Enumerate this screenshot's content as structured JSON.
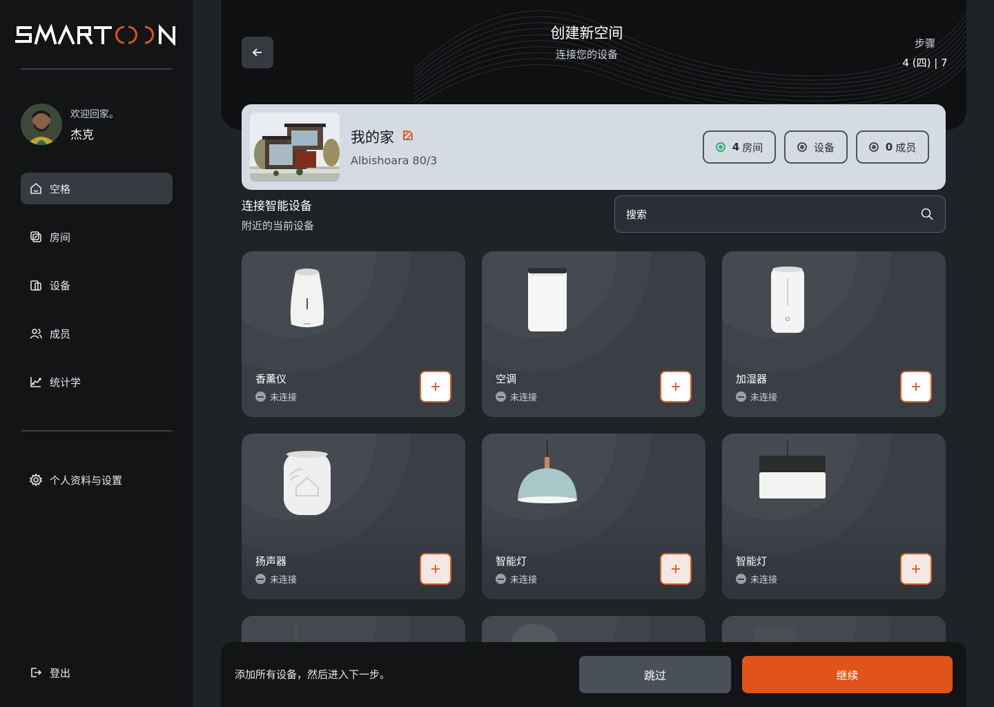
{
  "app": {
    "logo": "SMARTOON"
  },
  "user": {
    "greeting": "欢迎回家。",
    "name": "杰克"
  },
  "sidebar": {
    "items": [
      {
        "label": "空格",
        "icon": "home-icon",
        "active": true
      },
      {
        "label": "房间",
        "icon": "room-icon",
        "active": false
      },
      {
        "label": "设备",
        "icon": "device-icon",
        "active": false
      },
      {
        "label": "成员",
        "icon": "members-icon",
        "active": false
      },
      {
        "label": "统计学",
        "icon": "stats-icon",
        "active": false
      }
    ],
    "settings_label": "个人资料与设置",
    "logout_label": "登出"
  },
  "header": {
    "title": "创建新空间",
    "subtitle": "连接您的设备",
    "step_label": "步骤",
    "step_value": "4 (四) | 7"
  },
  "home": {
    "name": "我的家",
    "address": "Albishoara 80/3",
    "chips": [
      {
        "count": "4",
        "label": "房间",
        "dot_color": "#2fb36b"
      },
      {
        "count": "",
        "label": "设备",
        "dot_color": "#4a4f57"
      },
      {
        "count": "0",
        "label": "成员",
        "dot_color": "#4a4f57"
      }
    ]
  },
  "devices_section": {
    "title": "连接智能设备",
    "subtitle": "附近的当前设备",
    "search_placeholder": "搜索"
  },
  "devices": [
    {
      "name": "香薰仪",
      "status": "未连接",
      "icon": "diffuser-icon"
    },
    {
      "name": "空调",
      "status": "未连接",
      "icon": "air-conditioner-icon"
    },
    {
      "name": "加湿器",
      "status": "未连接",
      "icon": "humidifier-icon"
    },
    {
      "name": "扬声器",
      "status": "未连接",
      "icon": "speaker-icon"
    },
    {
      "name": "智能灯",
      "status": "未连接",
      "icon": "pendant-lamp-icon"
    },
    {
      "name": "智能灯",
      "status": "未连接",
      "icon": "drum-lamp-icon"
    }
  ],
  "footer": {
    "hint": "添加所有设备，然后进入下一步。",
    "skip_label": "跳过",
    "continue_label": "继续"
  },
  "colors": {
    "accent": "#e0531a",
    "connected": "#2fb36b"
  }
}
